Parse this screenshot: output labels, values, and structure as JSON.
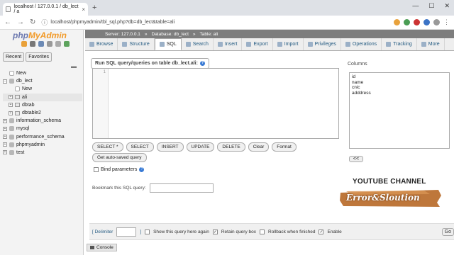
{
  "browser": {
    "tab_title": "localhost / 127.0.0.1 / db_lect / a",
    "url": "localhost/phpmyadmin/tbl_sql.php?db=db_lect&table=ali"
  },
  "logo": {
    "php": "php",
    "myadmin": "MyAdmin"
  },
  "left": {
    "recent": "Recent",
    "favorites": "Favorites",
    "tree": [
      {
        "label": "New",
        "level": 0,
        "kind": "new"
      },
      {
        "label": "db_lect",
        "level": 0,
        "kind": "db",
        "expanded": true
      },
      {
        "label": "New",
        "level": 1,
        "kind": "new"
      },
      {
        "label": "ali",
        "level": 1,
        "kind": "table",
        "selected": true
      },
      {
        "label": "dbtab",
        "level": 1,
        "kind": "table"
      },
      {
        "label": "dbtable2",
        "level": 1,
        "kind": "table"
      },
      {
        "label": "information_schema",
        "level": 0,
        "kind": "db"
      },
      {
        "label": "mysql",
        "level": 0,
        "kind": "db"
      },
      {
        "label": "performance_schema",
        "level": 0,
        "kind": "db"
      },
      {
        "label": "phpmyadmin",
        "level": 0,
        "kind": "db"
      },
      {
        "label": "test",
        "level": 0,
        "kind": "db"
      }
    ]
  },
  "breadcrumb": {
    "server": "Server: 127.0.0.1",
    "database": "Database: db_lect",
    "table": "Table: ali"
  },
  "tabs": [
    "Browse",
    "Structure",
    "SQL",
    "Search",
    "Insert",
    "Export",
    "Import",
    "Privileges",
    "Operations",
    "Tracking",
    "More"
  ],
  "active_tab": "SQL",
  "sql": {
    "header": "Run SQL query/queries on table db_lect.ali:",
    "line_number": "1",
    "columns_label": "Columns",
    "columns": [
      "id",
      "name",
      "cnic",
      "adddress"
    ],
    "buttons": [
      "SELECT *",
      "SELECT",
      "INSERT",
      "UPDATE",
      "DELETE",
      "Clear",
      "Format"
    ],
    "autosave": "Get auto-saved query",
    "insert_btn": "<<",
    "bind_params": "Bind parameters",
    "bookmark_label": "Bookmark this SQL query:"
  },
  "bottom": {
    "delimiter_label": "[ Delimiter",
    "delimiter_close": "]",
    "show_query": "Show this query here again",
    "retain": "Retain query box",
    "rollback": "Rollback when finished",
    "enable": "Enable",
    "go": "Go"
  },
  "console": "Console",
  "watermark": {
    "channel": "YOUTUBE CHANNEL",
    "name": "Error&Sloution"
  }
}
